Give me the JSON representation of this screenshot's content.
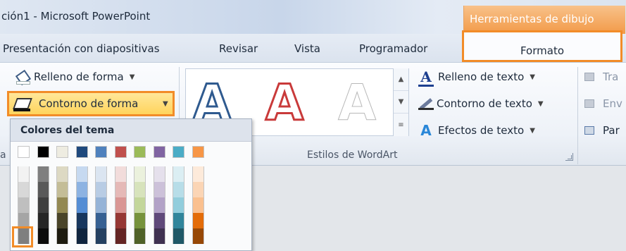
{
  "titlebar": {
    "title": "ción1  -  Microsoft PowerPoint",
    "tools_tab": "Herramientas de dibujo"
  },
  "tabs": {
    "presentacion": "Presentación con diapositivas",
    "revisar": "Revisar",
    "vista": "Vista",
    "programador": "Programador",
    "formato": "Formato"
  },
  "ribbon": {
    "shape_fill": "Relleno de forma",
    "shape_outline": "Contorno de forma",
    "text_fill": "Relleno de texto",
    "text_outline": "Contorno de texto",
    "text_effects": "Efectos de texto",
    "wordart_group": "Estilos de WordArt",
    "wordart_letter": "A",
    "arrange_1": "Tra",
    "arrange_2": "Env",
    "arrange_3": "Par",
    "left_group_fragment": "a"
  },
  "dropdown": {
    "header": "Colores del tema",
    "base_colors": [
      "#ffffff",
      "#000000",
      "#eeece1",
      "#1f497d",
      "#4f81bd",
      "#c0504d",
      "#9bbb59",
      "#8064a2",
      "#4bacc6",
      "#f79646"
    ],
    "shades": [
      [
        "#f2f2f2",
        "#d8d8d8",
        "#bfbfbf",
        "#a5a5a5",
        "#7f7f7f"
      ],
      [
        "#7f7f7f",
        "#595959",
        "#3f3f3f",
        "#262626",
        "#0c0c0c"
      ],
      [
        "#ddd9c3",
        "#c4bd97",
        "#938953",
        "#494429",
        "#1d1b10"
      ],
      [
        "#c6d9f0",
        "#8db3e2",
        "#548dd4",
        "#17365d",
        "#0f243e"
      ],
      [
        "#dbe5f1",
        "#b8cce4",
        "#95b3d7",
        "#366092",
        "#244061"
      ],
      [
        "#f2dcdb",
        "#e5b9b7",
        "#d99694",
        "#953734",
        "#632423"
      ],
      [
        "#ebf1dd",
        "#d7e3bc",
        "#c3d69b",
        "#76923c",
        "#4f6128"
      ],
      [
        "#e5e0ec",
        "#ccc1d9",
        "#b2a2c7",
        "#5f497a",
        "#3f3151"
      ],
      [
        "#dbeef3",
        "#b7dde8",
        "#92cddc",
        "#31859b",
        "#205867"
      ],
      [
        "#fdeada",
        "#fbd5b5",
        "#fac08f",
        "#e36c09",
        "#974806"
      ]
    ]
  }
}
